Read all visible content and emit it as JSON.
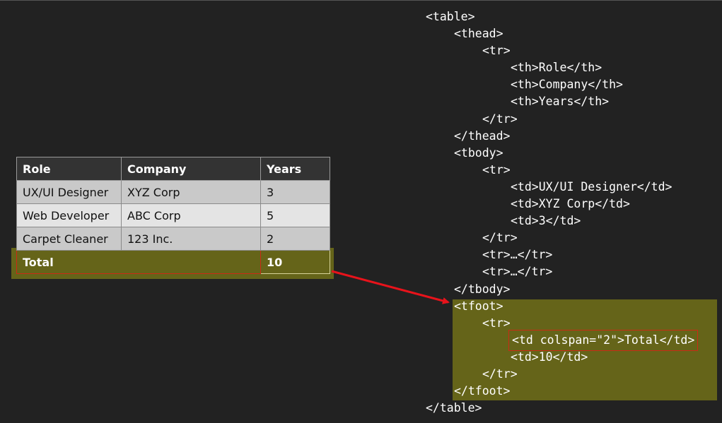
{
  "table": {
    "headers": [
      "Role",
      "Company",
      "Years"
    ],
    "rows": [
      [
        "UX/UI Designer",
        "XYZ Corp",
        "3"
      ],
      [
        "Web Developer",
        "ABC Corp",
        "5"
      ],
      [
        "Carpet Cleaner",
        "123 Inc.",
        "2"
      ]
    ],
    "footer": {
      "label": "Total",
      "value": "10"
    }
  },
  "code": {
    "lines": [
      "<table>",
      "<thead>",
      "<tr>",
      "<th>Role</th>",
      "<th>Company</th>",
      "<th>Years</th>",
      "</tr>",
      "</thead>",
      "<tbody>",
      "<tr>",
      "<td>UX/UI Designer</td>",
      "<td>XYZ Corp</td>",
      "<td>3</td>",
      "</tr>",
      "<tr>…</tr>",
      "<tr>…</tr>",
      "</tbody>",
      "<tfoot>",
      "<tr>",
      "<td colspan=\"2\">Total</td>",
      "<td>10</td>",
      "</tr>",
      "</tfoot>",
      "</table>"
    ]
  },
  "colors": {
    "background": "#222222",
    "highlight": "#656419",
    "annotation_red": "#cc2a14",
    "header_bg": "#333333"
  },
  "icons": {
    "arrow": "arrow-right-icon"
  }
}
